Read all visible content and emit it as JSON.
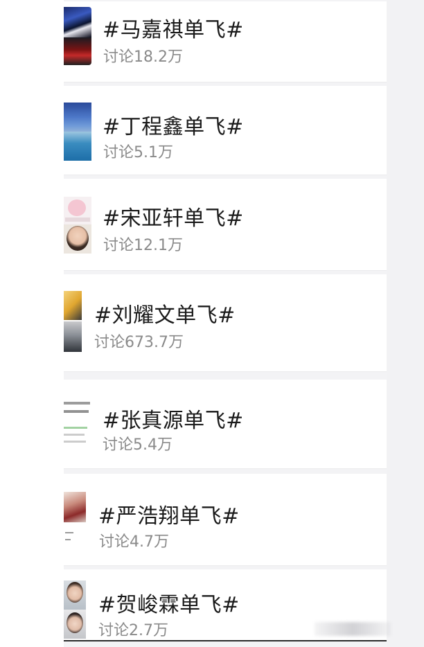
{
  "topics": [
    {
      "title": "#马嘉祺单飞#",
      "count": "讨论18.2万"
    },
    {
      "title": "#丁程鑫单飞#",
      "count": "讨论5.1万"
    },
    {
      "title": "#宋亚轩单飞#",
      "count": "讨论12.1万"
    },
    {
      "title": "#刘耀文单飞#",
      "count": "讨论673.7万"
    },
    {
      "title": "#张真源单飞#",
      "count": "讨论5.4万"
    },
    {
      "title": "#严浩翔单飞#",
      "count": "讨论4.7万"
    },
    {
      "title": "#贺峻霖单飞#",
      "count": "讨论2.7万"
    }
  ],
  "colors": {
    "background": "#f3f3f5",
    "card": "#ffffff",
    "title_text": "#1a1a1a",
    "count_text": "#8a8a8a"
  }
}
